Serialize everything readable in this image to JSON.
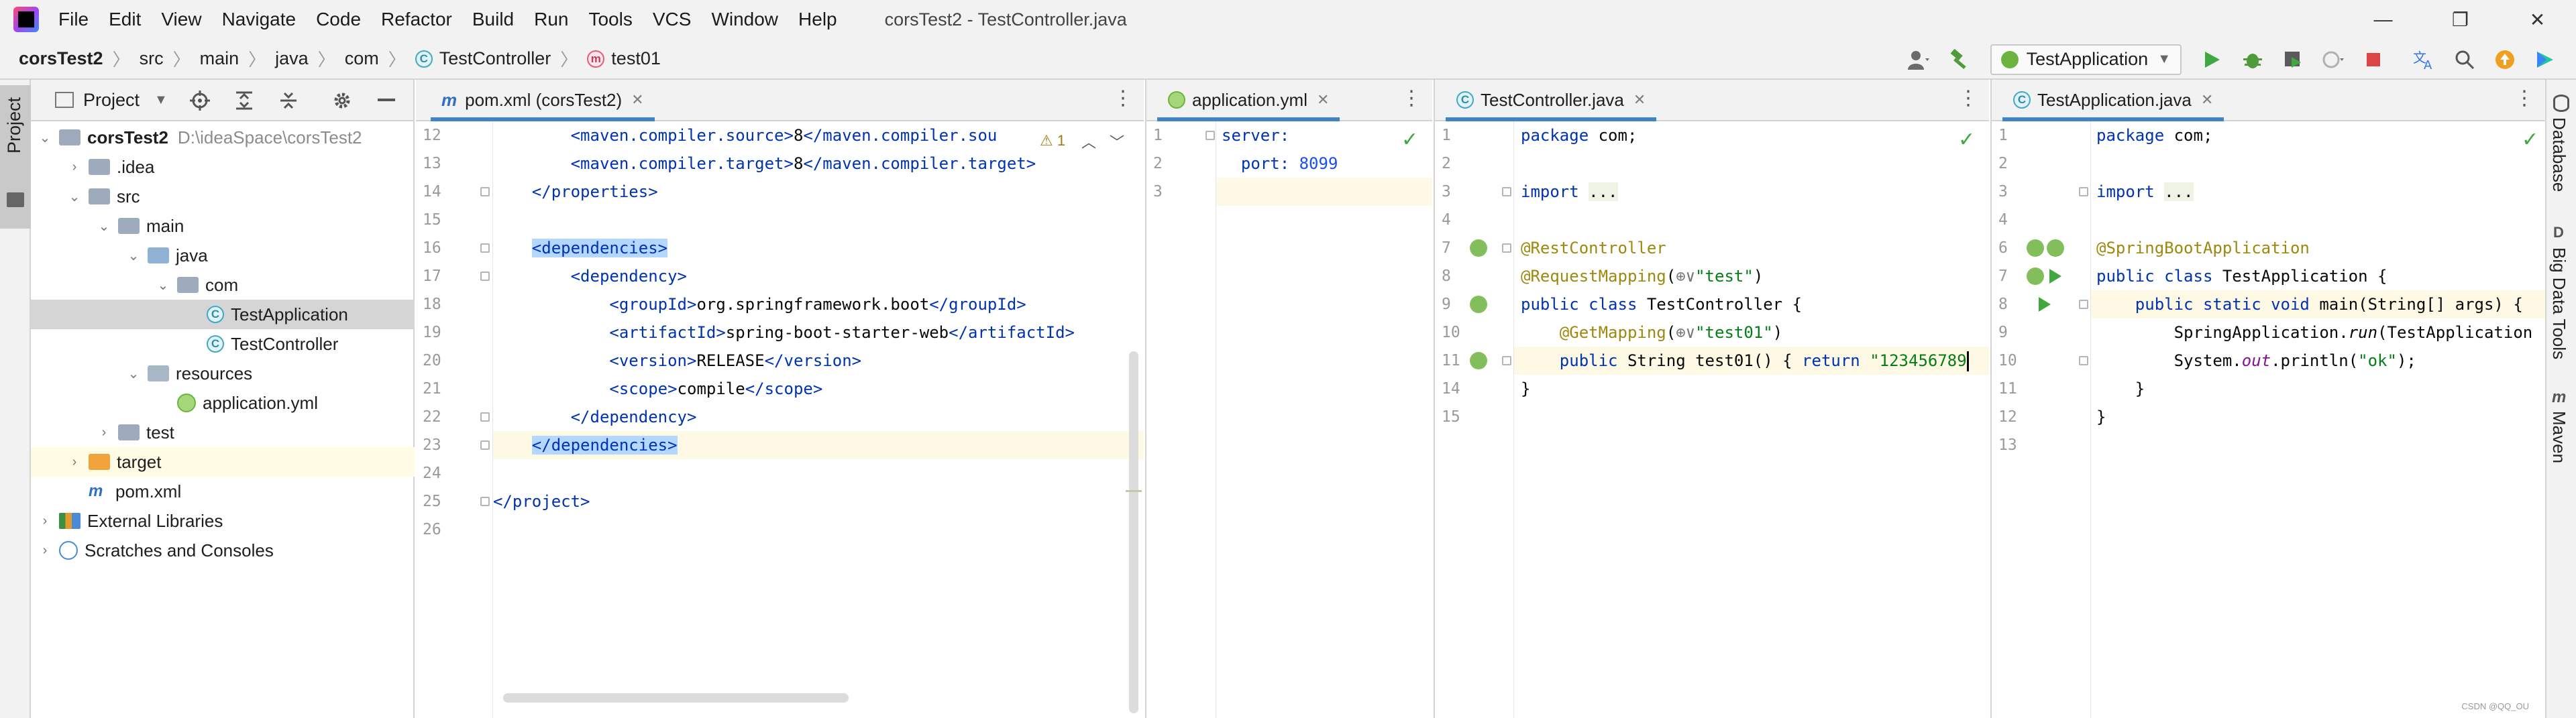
{
  "window": {
    "title": "corsTest2 - TestController.java",
    "menu": [
      "File",
      "Edit",
      "View",
      "Navigate",
      "Code",
      "Refactor",
      "Build",
      "Run",
      "Tools",
      "VCS",
      "Window",
      "Help"
    ],
    "controls": {
      "minimize": "—",
      "restore": "❐",
      "close": "✕"
    }
  },
  "breadcrumb": {
    "project": "corsTest2",
    "items": [
      "src",
      "main",
      "java",
      "com"
    ],
    "class_name": "TestController",
    "method_name": "test01",
    "class_icon_letter": "C",
    "method_icon_letter": "m"
  },
  "toolbar": {
    "run_config": "TestApplication",
    "icons": [
      "user-icon",
      "hammer-icon",
      "run-icon",
      "debug-icon",
      "coverage-icon",
      "profile-icon",
      "stop-icon",
      "translate-icon",
      "search-icon",
      "update-icon",
      "logo-icon"
    ]
  },
  "tool_strips": {
    "left": [
      "Project"
    ],
    "right": [
      "Database",
      "Big Data Tools",
      "Maven"
    ]
  },
  "project_panel": {
    "title": "Project",
    "tree": [
      {
        "label": "corsTest2",
        "hint": "D:\\ideaSpace\\corsTest2",
        "depth": 0,
        "toggle": "open",
        "icon": "module"
      },
      {
        "label": ".idea",
        "depth": 1,
        "toggle": "closed",
        "icon": "folder"
      },
      {
        "label": "src",
        "depth": 1,
        "toggle": "open",
        "icon": "folder"
      },
      {
        "label": "main",
        "depth": 2,
        "toggle": "open",
        "icon": "folder"
      },
      {
        "label": "java",
        "depth": 3,
        "toggle": "open",
        "icon": "folder-src"
      },
      {
        "label": "com",
        "depth": 4,
        "toggle": "open",
        "icon": "folder"
      },
      {
        "label": "TestApplication",
        "depth": 5,
        "toggle": "none",
        "icon": "class",
        "selected": true
      },
      {
        "label": "TestController",
        "depth": 5,
        "toggle": "none",
        "icon": "class"
      },
      {
        "label": "resources",
        "depth": 3,
        "toggle": "open",
        "icon": "folder-res"
      },
      {
        "label": "application.yml",
        "depth": 4,
        "toggle": "none",
        "icon": "yml"
      },
      {
        "label": "test",
        "depth": 2,
        "toggle": "closed",
        "icon": "folder"
      },
      {
        "label": "target",
        "depth": 1,
        "toggle": "closed",
        "icon": "folder-orange",
        "highlight": true
      },
      {
        "label": "pom.xml",
        "depth": 1,
        "toggle": "none",
        "icon": "maven"
      },
      {
        "label": "External Libraries",
        "depth": 0,
        "toggle": "closed",
        "icon": "libs"
      },
      {
        "label": "Scratches and Consoles",
        "depth": 0,
        "toggle": "closed",
        "icon": "scratch"
      }
    ]
  },
  "editors": {
    "pom": {
      "tab": "pom.xml (corsTest2)",
      "tab_icon": "m",
      "warning": "⚠ 1",
      "line_numbers": [
        "12",
        "13",
        "14",
        "15",
        "16",
        "17",
        "18",
        "19",
        "20",
        "21",
        "22",
        "23",
        "24",
        "25",
        "26"
      ]
    },
    "yml": {
      "tab": "application.yml",
      "line_numbers": [
        "1",
        "2",
        "3"
      ]
    },
    "controller": {
      "tab": "TestController.java",
      "line_numbers": [
        "1",
        "2",
        "3",
        "4",
        "7",
        "8",
        "9",
        "10",
        "11",
        "14",
        "15"
      ]
    },
    "application": {
      "tab": "TestApplication.java",
      "line_numbers": [
        "1",
        "2",
        "3",
        "4",
        "6",
        "7",
        "8",
        "9",
        "10",
        "11",
        "12",
        "13"
      ]
    }
  },
  "watermark": "CSDN @QQ_OU"
}
